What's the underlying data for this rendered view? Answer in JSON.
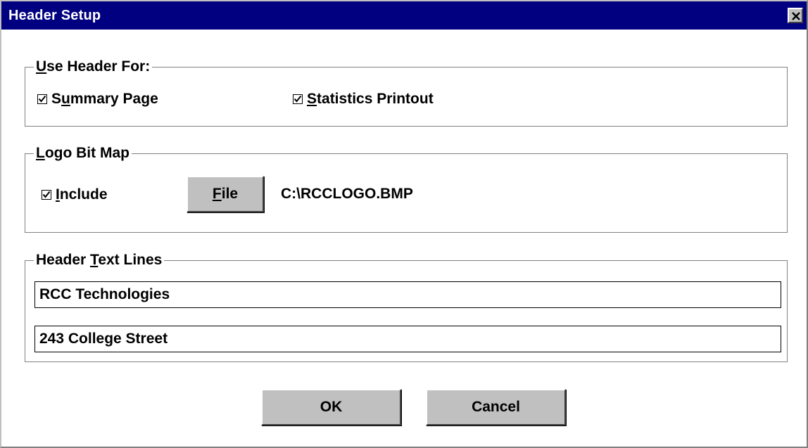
{
  "window": {
    "title": "Header Setup"
  },
  "use_header_for": {
    "legend_prefix": "",
    "legend_mnemonic": "U",
    "legend_rest": "se Header For:",
    "summary_page": {
      "pre": "S",
      "mnemonic": "u",
      "post": "mmary Page",
      "checked": true
    },
    "statistics_printout": {
      "pre": "",
      "mnemonic": "S",
      "post": "tatistics Printout",
      "checked": true
    }
  },
  "logo_bit_map": {
    "legend_mnemonic": "L",
    "legend_rest": "ogo Bit Map",
    "include": {
      "pre": "",
      "mnemonic": "I",
      "post": "nclude",
      "checked": true
    },
    "file_button": {
      "mnemonic": "F",
      "rest": "ile"
    },
    "file_path": "C:\\RCCLOGO.BMP"
  },
  "header_text_lines": {
    "legend_prefix": "Header ",
    "legend_mnemonic": "T",
    "legend_rest": "ext Lines",
    "line1": "RCC Technologies",
    "line2": "243 College Street"
  },
  "buttons": {
    "ok": "OK",
    "cancel": "Cancel"
  },
  "colors": {
    "titlebar": "#000080",
    "button_face": "#c0c0c0",
    "window_bg": "#ffffff"
  }
}
